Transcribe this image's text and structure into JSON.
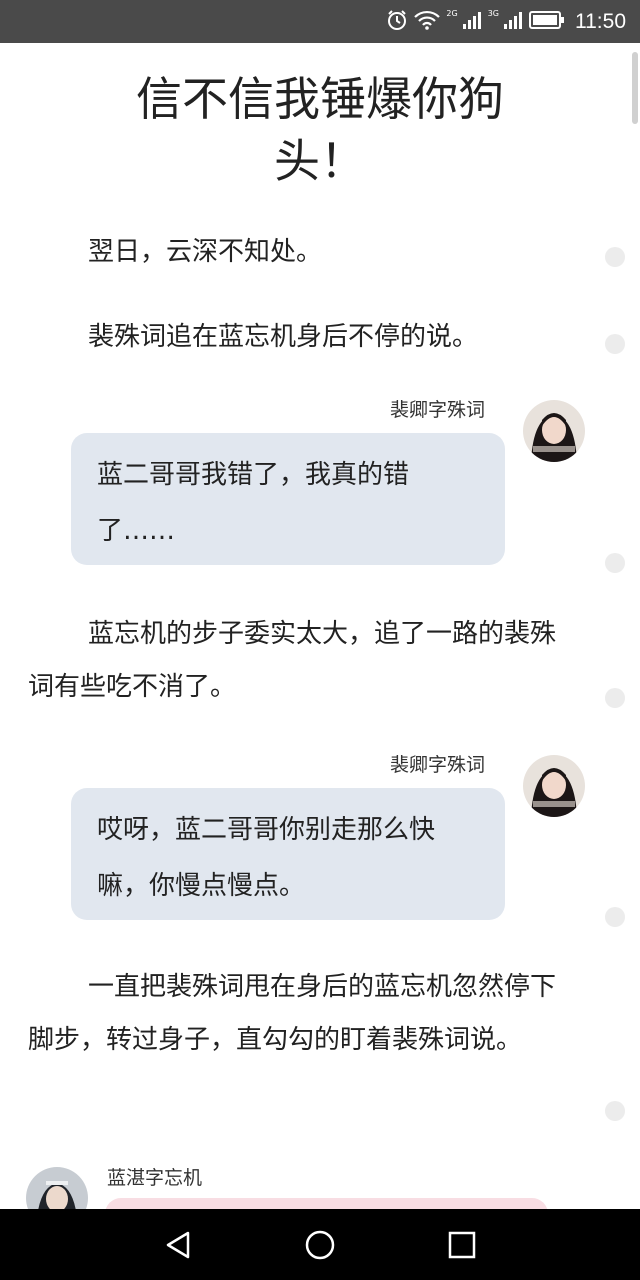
{
  "status_bar": {
    "time": "11:50",
    "network_2g": "2G",
    "network_3g": "3G",
    "icons": [
      "alarm-icon",
      "wifi-icon",
      "signal-2g-icon",
      "signal-3g-icon",
      "battery-icon"
    ]
  },
  "article": {
    "title": "信不信我锤爆你狗头！",
    "paragraphs": [
      "翌日，云深不知处。",
      "裴殊词追在蓝忘机身后不停的说。",
      "蓝忘机的步子委实太大，追了一路的裴殊词有些吃不消了。",
      "一直把裴殊词甩在身后的蓝忘机忽然停下脚步，转过身子，直勾勾的盯着裴殊词说。"
    ],
    "messages": [
      {
        "sender": "裴卿字殊词",
        "text": "蓝二哥哥我错了，我真的错了……"
      },
      {
        "sender": "裴卿字殊词",
        "text": "哎呀，蓝二哥哥你别走那么快嘛，你慢点慢点。"
      },
      {
        "sender": "蓝湛字忘机",
        "text": ""
      }
    ]
  },
  "colors": {
    "status_bar_bg": "#4a4a4a",
    "bubble_right_bg": "#e1e7ef",
    "bubble_left_bg": "#f8dde3",
    "nav_bar_bg": "#000000"
  },
  "nav_bar": {
    "icons": [
      "back-triangle-icon",
      "home-circle-icon",
      "recent-square-icon"
    ]
  }
}
